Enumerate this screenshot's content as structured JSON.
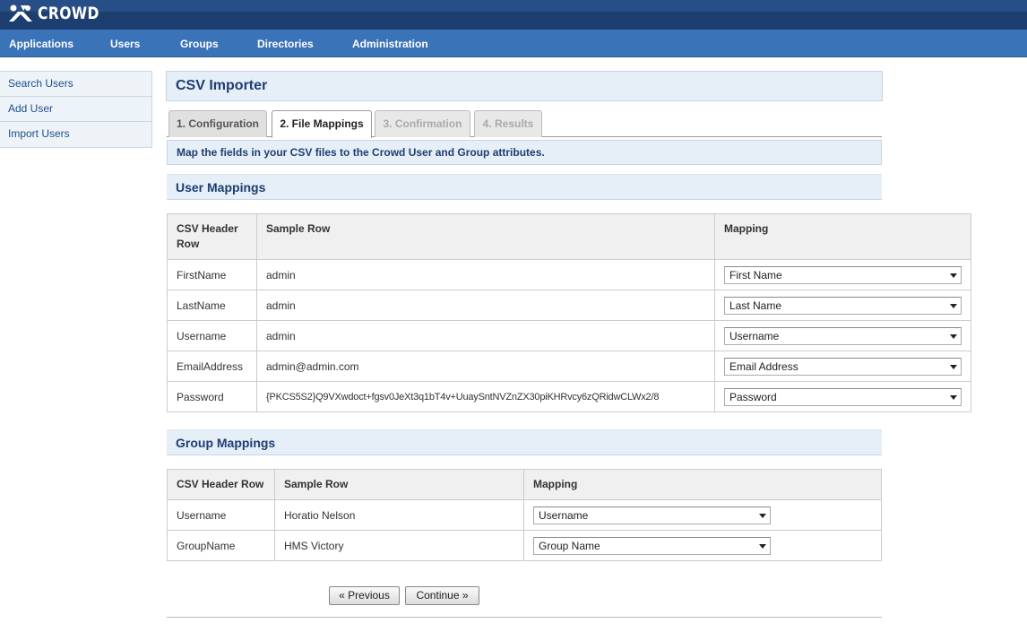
{
  "header": {
    "logo_text": "CROWD"
  },
  "nav": {
    "items": [
      "Applications",
      "Users",
      "Groups",
      "Directories",
      "Administration"
    ]
  },
  "sidebar": {
    "items": [
      "Search Users",
      "Add User",
      "Import Users"
    ]
  },
  "page": {
    "title": "CSV Importer",
    "tabs": [
      {
        "label": "1. Configuration",
        "state": "normal"
      },
      {
        "label": "2. File Mappings",
        "state": "active"
      },
      {
        "label": "3. Confirmation",
        "state": "disabled"
      },
      {
        "label": "4. Results",
        "state": "disabled"
      }
    ],
    "description": "Map the fields in your CSV files to the Crowd User and Group attributes."
  },
  "user_mappings": {
    "heading": "User Mappings",
    "columns": {
      "header": "CSV Header Row",
      "sample": "Sample Row",
      "mapping": "Mapping"
    },
    "rows": [
      {
        "header": "FirstName",
        "sample": "admin",
        "mapping": "First Name"
      },
      {
        "header": "LastName",
        "sample": "admin",
        "mapping": "Last Name"
      },
      {
        "header": "Username",
        "sample": "admin",
        "mapping": "Username"
      },
      {
        "header": "EmailAddress",
        "sample": "admin@admin.com",
        "mapping": "Email Address"
      },
      {
        "header": "Password",
        "sample": "{PKCS5S2}Q9VXwdoct+fgsv0JeXt3q1bT4v+UuaySntNVZnZX30piKHRvcy6zQRidwCLWx2/8",
        "mapping": "Password"
      }
    ]
  },
  "group_mappings": {
    "heading": "Group Mappings",
    "columns": {
      "header": "CSV Header Row",
      "sample": "Sample Row",
      "mapping": "Mapping"
    },
    "rows": [
      {
        "header": "Username",
        "sample": "Horatio Nelson",
        "mapping": "Username"
      },
      {
        "header": "GroupName",
        "sample": "HMS Victory",
        "mapping": "Group Name"
      }
    ]
  },
  "buttons": {
    "previous": "« Previous",
    "continue": "Continue »"
  },
  "colors": {
    "header_dark": "#1d3f70",
    "nav_blue": "#3b73b9",
    "panel_bg": "#e6eef7",
    "heading_text": "#1d3f70"
  }
}
